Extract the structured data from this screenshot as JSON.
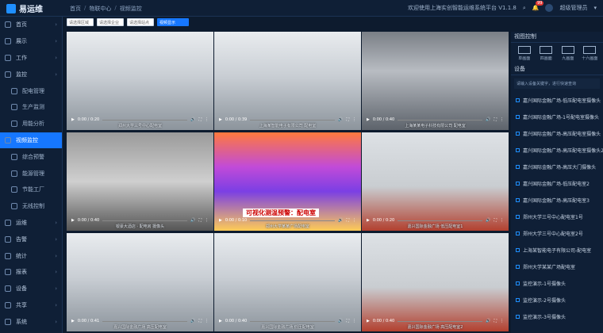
{
  "app": {
    "name": "易运维"
  },
  "breadcrumb": [
    "首页",
    "物联中心",
    "视频监控"
  ],
  "header": {
    "notice": "欢迎使用上海实创智能运维系统平台 V1.1.8",
    "alert_count": "99",
    "user": "超级管理员"
  },
  "sidebar": {
    "items": [
      {
        "label": "首页",
        "kind": "top"
      },
      {
        "label": "展示",
        "kind": "top"
      },
      {
        "label": "工作",
        "kind": "top"
      },
      {
        "label": "监控",
        "kind": "top"
      },
      {
        "label": "配电管理",
        "kind": "sub"
      },
      {
        "label": "生产监测",
        "kind": "sub"
      },
      {
        "label": "用能分析",
        "kind": "sub"
      },
      {
        "label": "视频监控",
        "kind": "active"
      },
      {
        "label": "综合预警",
        "kind": "sub"
      },
      {
        "label": "能源管理",
        "kind": "sub"
      },
      {
        "label": "节能工厂",
        "kind": "sub"
      },
      {
        "label": "无线控制",
        "kind": "sub"
      },
      {
        "label": "运维",
        "kind": "top"
      },
      {
        "label": "告警",
        "kind": "top"
      },
      {
        "label": "统计",
        "kind": "top"
      },
      {
        "label": "报表",
        "kind": "top"
      },
      {
        "label": "设备",
        "kind": "top"
      },
      {
        "label": "共享",
        "kind": "top"
      },
      {
        "label": "系统",
        "kind": "top"
      }
    ]
  },
  "filters": {
    "f1": "请选择区域",
    "f2": "请选择企业",
    "f3": "请选择站点",
    "btn": "视频显示"
  },
  "cameras": [
    {
      "caption": "郑州大学三号中心配电室",
      "time": "0:00 / 0:20",
      "theme": "light"
    },
    {
      "caption": "上海某智能电子有限公司 配电室",
      "time": "0:00 / 0:39",
      "theme": "light"
    },
    {
      "caption": "上海某某电子科技有限公司 配电室",
      "time": "0:00 / 0:40",
      "theme": "dark"
    },
    {
      "caption": "银豪大酒店 · 配电房 摄像头",
      "time": "0:00 / 0:40",
      "theme": "gray"
    },
    {
      "caption": "郑州大学某某广场配电室",
      "time": "0:00 / 0:10",
      "theme": "thermal",
      "label": "可视化测温预警：配电室"
    },
    {
      "caption": "嘉兴国际金融广场 低压配电室1",
      "time": "0:00 / 0:20",
      "theme": "red"
    },
    {
      "caption": "嘉兴国际金融广场 高压配电室",
      "time": "0:00 / 0:41",
      "theme": "light"
    },
    {
      "caption": "嘉兴国际金融广场 低压配电室",
      "time": "0:00 / 0:40",
      "theme": "light"
    },
    {
      "caption": "嘉兴国际金融广场 高压配电室2",
      "time": "0:00 / 0:40",
      "theme": "red"
    }
  ],
  "right_panel": {
    "title": "视图控制",
    "layouts": [
      "单画面",
      "四画面",
      "九画面",
      "十六画面"
    ],
    "list_title": "设备",
    "hint": "请输入设备关键字，进行快速查询",
    "devices": [
      "嘉兴国际金融广场-低压配电室摄像头",
      "嘉兴国际金融广场-1号配电室摄像头",
      "嘉兴国际金融广场-高压配电室摄像头",
      "嘉兴国际金融广场-高压配电室摄像头2",
      "嘉兴国际金融广场-高压大门摄像头",
      "嘉兴国际金融广场-低压配电室2",
      "嘉兴国际金融广场-高压配电室3",
      "郑州大学三号中心配电室1号",
      "郑州大学三号中心配电室2号",
      "上海某智能电子有限公司-配电室",
      "郑州大学某某广场配电室",
      "监控演示-1号摄像头",
      "监控演示-2号摄像头",
      "监控演示-3号摄像头"
    ]
  }
}
